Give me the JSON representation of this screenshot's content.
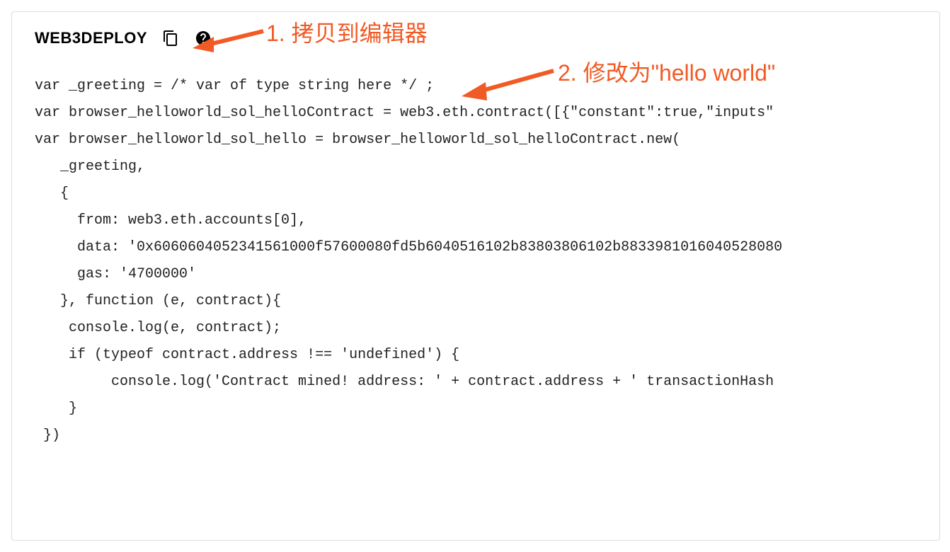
{
  "panel": {
    "title": "WEB3DEPLOY",
    "icons": {
      "copy": "copy-icon",
      "help": "help-icon"
    }
  },
  "code": {
    "l1": "var _greeting = /* var of type string here */ ;",
    "l2": "var browser_helloworld_sol_helloContract = web3.eth.contract([{\"constant\":true,\"inputs\"",
    "l3": "var browser_helloworld_sol_hello = browser_helloworld_sol_helloContract.new(",
    "l4": "   _greeting,",
    "l5": "   {",
    "l6": "     from: web3.eth.accounts[0], ",
    "l7": "     data: '0x6060604052341561000f57600080fd5b6040516102b83803806102b8833981016040528080",
    "l8": "     gas: '4700000'",
    "l9": "   }, function (e, contract){",
    "l10": "    console.log(e, contract);",
    "l11": "    if (typeof contract.address !== 'undefined') {",
    "l12": "         console.log('Contract mined! address: ' + contract.address + ' transactionHash",
    "l13": "    }",
    "l14": " })"
  },
  "annotations": {
    "a1": "1. 拷贝到编辑器",
    "a2": "2. 修改为\"hello world\""
  }
}
